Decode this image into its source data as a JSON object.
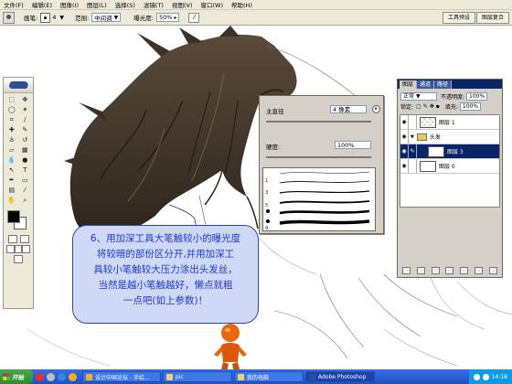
{
  "menubar": {
    "items": [
      "文件(F)",
      "编辑(E)",
      "图像(I)",
      "图层(L)",
      "选择(S)",
      "滤镜(T)",
      "视图(V)",
      "窗口(W)",
      "帮助(H)"
    ]
  },
  "options": {
    "brush_label": "画笔:",
    "brush_size": "4",
    "range_label": "范围:",
    "range_value": "中间调",
    "exposure_label": "曝光度:",
    "exposure_value": "50%"
  },
  "palette_well": {
    "tabs": [
      "工具预设",
      "图层复合"
    ]
  },
  "brush_panel": {
    "diameter_label": "主直径",
    "diameter_value": "4 像素",
    "hardness_label": "硬度:",
    "hardness_value": "100%",
    "presets": [
      "1",
      "3",
      "5",
      "9"
    ]
  },
  "layers": {
    "tabs": [
      "图层",
      "通道",
      "路径"
    ],
    "blend_mode": "正常",
    "opacity_label": "不透明度:",
    "opacity_value": "100%",
    "lock_label": "锁定:",
    "fill_label": "填充:",
    "fill_value": "100%",
    "items": [
      "图层 1",
      "头发",
      "图层 3",
      "图层 0"
    ]
  },
  "annotation": {
    "lines": [
      "6、用加深工具大笔触较小的曝光度",
      "将较暗的部份区分开,并用加深工",
      "具较小笔触较大压力涂出头发丝，",
      "当然是越小笔触越好，懒点就粗",
      "一点吧(如上参数)！"
    ],
    "color": "#1c3acc"
  },
  "taskbar": {
    "start_label": "开始",
    "tasks": [
      "设计中国论坛 - 手绘…",
      "pic",
      "我的电脑",
      "Adobe Photoshop"
    ],
    "clock": "14:18"
  }
}
